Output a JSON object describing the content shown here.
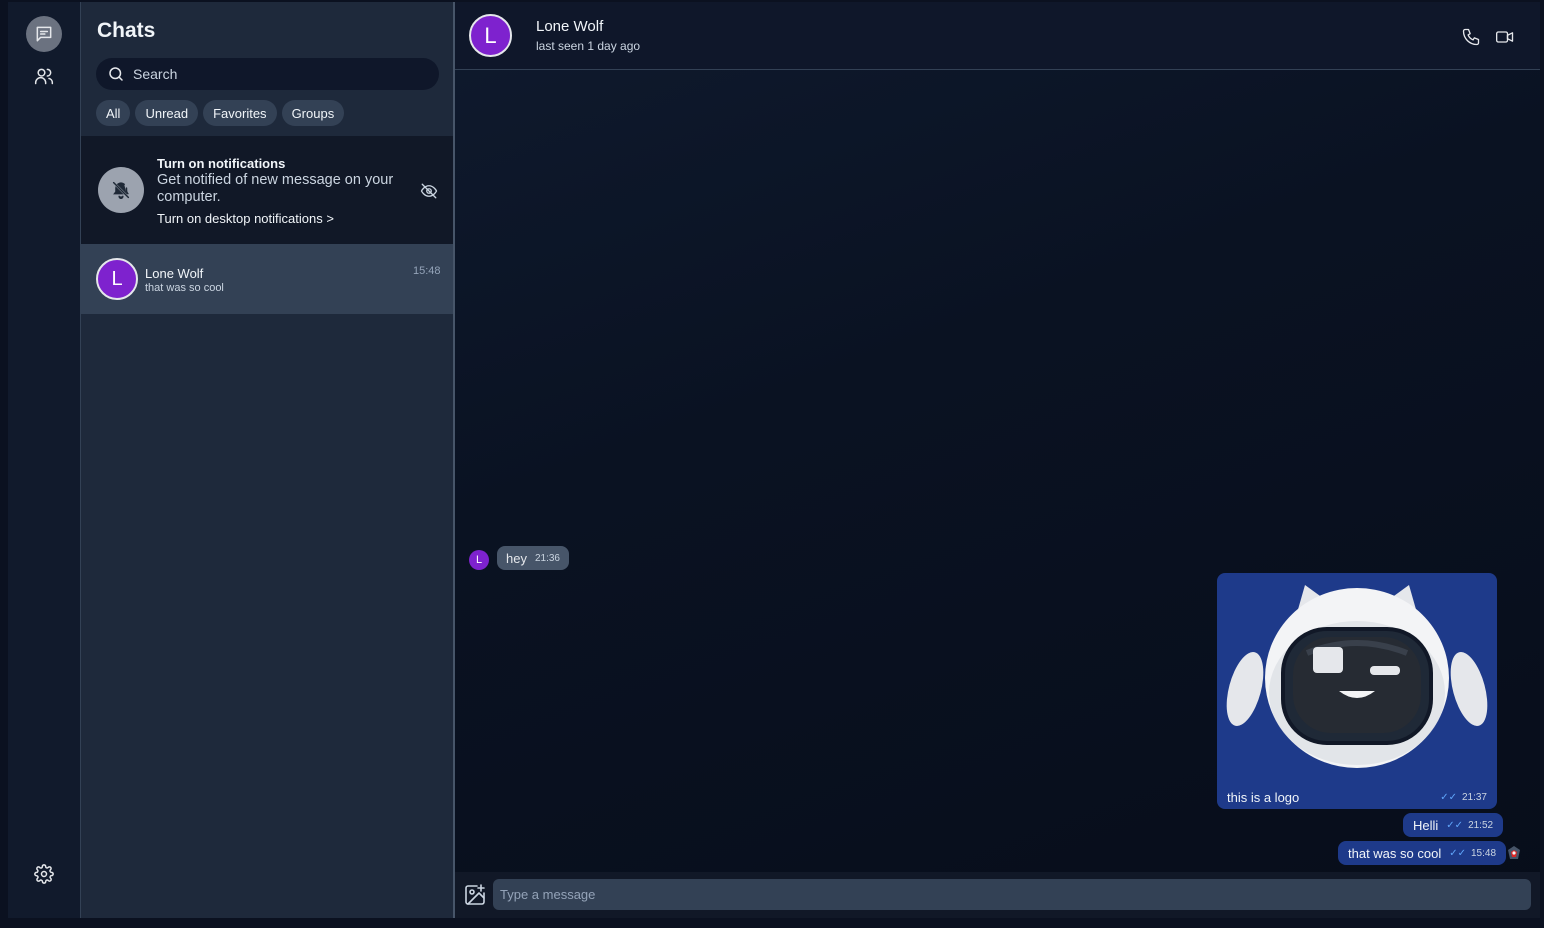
{
  "rail": {
    "items": [
      {
        "icon": "chat-icon",
        "active": true
      },
      {
        "icon": "users-icon",
        "active": false
      }
    ],
    "bottom_icon": "gear-icon"
  },
  "chat_list": {
    "title": "Chats",
    "search_placeholder": "Search",
    "filters": [
      "All",
      "Unread",
      "Favorites",
      "Groups"
    ],
    "notification": {
      "title": "Turn on notifications",
      "description": "Get notified of new message on your computer.",
      "link": "Turn on desktop notifications >",
      "icon": "bell-off-icon",
      "dismiss_icon": "eye-off-icon"
    },
    "chats": [
      {
        "initial": "L",
        "name": "Lone Wolf",
        "preview": "that was so cool",
        "time": "15:48"
      }
    ]
  },
  "conversation": {
    "contact": {
      "initial": "L",
      "name": "Lone Wolf",
      "status": "last seen 1 day ago"
    },
    "header_icons": [
      "phone-icon",
      "video-icon"
    ],
    "messages": [
      {
        "direction": "in",
        "text": "hey",
        "time": "21:36"
      },
      {
        "direction": "out",
        "type": "image",
        "caption": "this is a logo",
        "time": "21:37",
        "ticks": "✓✓"
      },
      {
        "direction": "out",
        "text": "Helli",
        "time": "21:52",
        "ticks": "✓✓"
      },
      {
        "direction": "out",
        "text": "that was so cool",
        "time": "15:48",
        "ticks": "✓✓"
      }
    ],
    "composer_placeholder": "Type a message",
    "attach_icon": "image-add-icon"
  },
  "colors": {
    "accent": "#7e22ce",
    "outgoing_bubble": "#1e3a8a",
    "incoming_bubble": "#475569",
    "panel": "#1e293b"
  }
}
